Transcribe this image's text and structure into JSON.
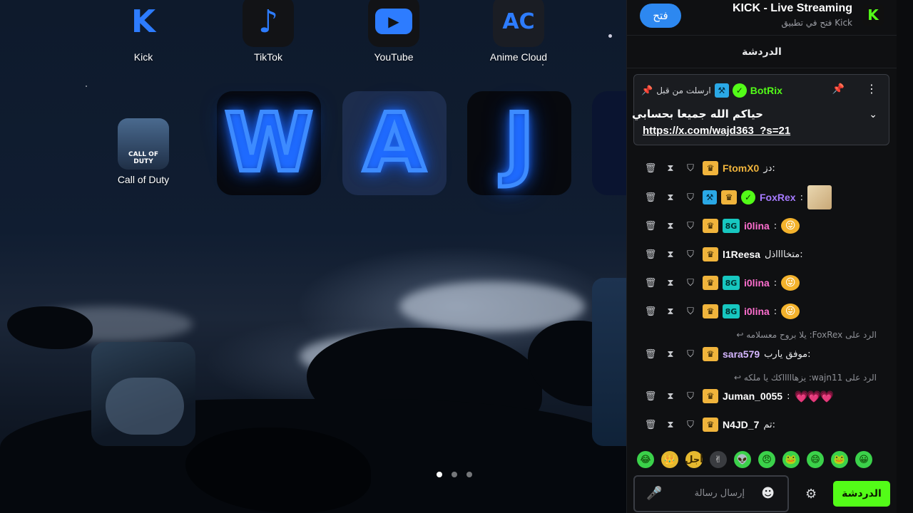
{
  "home": {
    "apps": [
      {
        "label": "Kick",
        "glyph": "K",
        "bg": "#1a1d22",
        "color": "#53fc18"
      },
      {
        "label": "TikTok",
        "glyph": "♪",
        "bg": "#111",
        "color": "#ffffff"
      },
      {
        "label": "YouTube",
        "glyph": "▶",
        "bg": "#111",
        "color": "#ff2a2a"
      },
      {
        "label": "Anime Cloud",
        "glyph": "AC",
        "bg": "#1e2330",
        "color": "#3d8bff"
      },
      {
        "label": "Call of Duty",
        "glyph": "CALL OF DUTY",
        "bg": "#2c3e57",
        "color": "#ffffff"
      }
    ],
    "neon_tiles": [
      "W",
      "A",
      "J"
    ],
    "page_dots": 3,
    "active_page": 1
  },
  "kick": {
    "open_button": "فتح",
    "title": "KICK - Live Streaming",
    "subtitle": "فتح في تطبيق Kick",
    "logo_glyph": "K",
    "chat_title": "الدردشة",
    "pinned": {
      "user": "BotRix",
      "sent_label": "ارسلت من قبل",
      "message": "حياكم الله جميعا بحسابي",
      "link": "https://x.com/wajd363_?s=21"
    },
    "messages": [
      {
        "user": "FtomX0",
        "user_color": "#f0b43c",
        "text": ":دز",
        "badges": [
          "crown"
        ]
      },
      {
        "user": "FoxRex",
        "user_color": "#a67bff",
        "text": ":",
        "badges": [
          "sword",
          "crown",
          "verified"
        ],
        "avatar": true
      },
      {
        "user": "i0lina",
        "user_color": "#ff6fcf",
        "text": ":",
        "badges": [
          "crown",
          "sub"
        ],
        "emote": "😜"
      },
      {
        "user": "l1Reesa",
        "user_color": "#ffffff",
        "text": ":متخااااذل",
        "badges": [
          "crown"
        ]
      },
      {
        "user": "i0lina",
        "user_color": "#ff6fcf",
        "text": ":",
        "badges": [
          "crown",
          "sub"
        ],
        "emote": "😜"
      },
      {
        "user": "i0lina",
        "user_color": "#ff6fcf",
        "text": ":",
        "badges": [
          "crown",
          "sub"
        ],
        "emote": "😜"
      },
      {
        "reply": "الرد على FoxRex: يلا بروح معسلامه ↩"
      },
      {
        "user": "sara579",
        "user_color": "#d5b6ff",
        "text": ":موفق يارب",
        "badges": [
          "crown"
        ]
      },
      {
        "reply": "الرد على wajn11: يزهاااااكك يا ملكه ↩"
      },
      {
        "user": "Juman_0055",
        "user_color": "#ffffff",
        "text": ":",
        "badges": [
          "crown"
        ],
        "hearts": "💗💗💗"
      },
      {
        "user": "N4JD_7",
        "user_color": "#ffffff",
        "text": ":تم",
        "badges": [
          "crown"
        ]
      }
    ],
    "emotes": [
      "😂",
      "👑",
      "أجل",
      "✌",
      "👽",
      "😠",
      "🐸",
      "😄",
      "🐸",
      "😀"
    ],
    "chat_button": "الدردشة",
    "input_placeholder": "إرسال رسالة"
  }
}
